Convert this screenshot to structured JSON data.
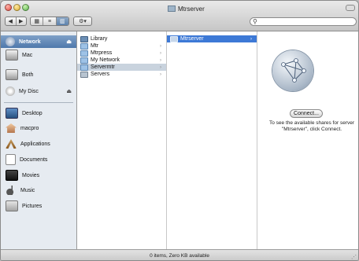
{
  "window": {
    "title": "Mtrserver",
    "status": "0 items, Zero KB available"
  },
  "toolbar": {
    "back": "◀",
    "forward": "▶",
    "view_icon": "▦",
    "view_list": "≡",
    "view_column": "▥",
    "action": "⚙▾",
    "search_placeholder": "",
    "search_glyph": "⚲"
  },
  "sidebar": {
    "items": [
      {
        "label": "Network",
        "icon": "network-globe-icon",
        "eject": "⏏",
        "selected": true
      },
      {
        "label": "Mac",
        "icon": "computer-icon"
      },
      {
        "label": "Both",
        "icon": "computer-icon"
      },
      {
        "label": "My Disc",
        "icon": "disc-icon",
        "eject": "⏏"
      },
      {
        "label": "Desktop",
        "icon": "desktop-icon"
      },
      {
        "label": "macpro",
        "icon": "home-icon"
      },
      {
        "label": "Applications",
        "icon": "applications-icon"
      },
      {
        "label": "Documents",
        "icon": "documents-icon"
      },
      {
        "label": "Movies",
        "icon": "movies-icon"
      },
      {
        "label": "Music",
        "icon": "music-icon"
      },
      {
        "label": "Pictures",
        "icon": "pictures-icon"
      }
    ]
  },
  "columns": [
    {
      "rows": [
        {
          "label": "Library",
          "icon": "library-icon"
        },
        {
          "label": "Mtr",
          "icon": "folder-icon",
          "chevron": "›"
        },
        {
          "label": "Mtrpress",
          "icon": "folder-icon",
          "chevron": "›"
        },
        {
          "label": "My Network",
          "icon": "folder-icon",
          "chevron": "›"
        },
        {
          "label": "Servermtr",
          "icon": "folder-icon",
          "chevron": "›",
          "highlight": true
        },
        {
          "label": "Servers",
          "icon": "servers-icon",
          "chevron": "›"
        }
      ]
    },
    {
      "rows": [
        {
          "label": "Mtrserver",
          "icon": "server-icon",
          "chevron": "›",
          "selected": true
        }
      ]
    }
  ],
  "preview": {
    "connect_label": "Connect...",
    "hint": "To see the available shares for server \"Mtrserver\", click Connect."
  },
  "colors": {
    "selection": "#3d79d6",
    "sidebar_bg": "#e6ebf1"
  }
}
